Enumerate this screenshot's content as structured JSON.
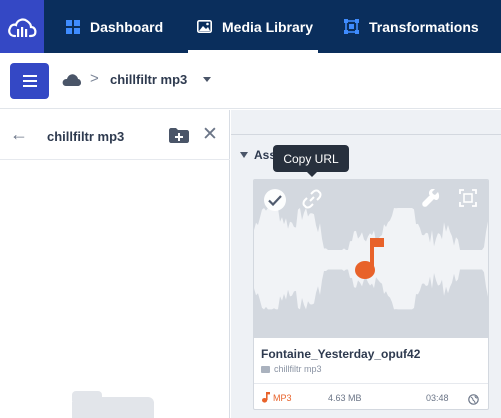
{
  "nav": {
    "logo_icon": "cloud-logo-icon",
    "tabs": [
      {
        "label": "Dashboard",
        "icon": "grid-icon"
      },
      {
        "label": "Media Library",
        "icon": "image-icon",
        "active": true
      },
      {
        "label": "Transformations",
        "icon": "transform-icon"
      }
    ]
  },
  "toolbar": {
    "menu_icon": "hamburger-icon",
    "breadcrumb": {
      "root_icon": "cloud-icon",
      "separator": ">",
      "folder": "chillfiltr mp3"
    }
  },
  "left_panel": {
    "title": "chillfiltr mp3"
  },
  "main": {
    "section_label": "Ass",
    "tooltip": "Copy URL",
    "asset": {
      "name": "Fontaine_Yesterday_opuf42",
      "folder": "chillfiltr mp3",
      "type": "MP3",
      "size": "4.63 MB",
      "duration": "03:48"
    }
  },
  "colors": {
    "nav_bg": "#0a2e5c",
    "accent": "#3448c5",
    "audio_orange": "#e8622a",
    "panel_bg": "#eef1f5"
  }
}
